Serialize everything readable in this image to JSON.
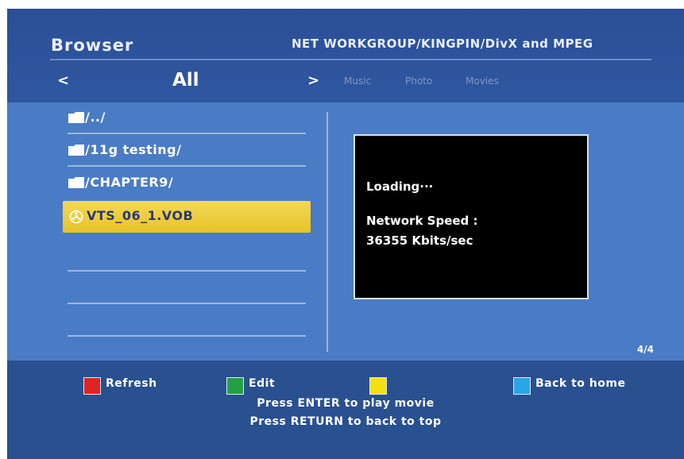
{
  "header": {
    "title": "Browser",
    "path": "NET WORKGROUP/KINGPIN/DivX and MPEG"
  },
  "nav": {
    "prev_icon": "chevron-left",
    "prev_glyph": "<",
    "current": "All",
    "next_icon": "chevron-right",
    "next_glyph": ">",
    "tabs": [
      "Music",
      "Photo",
      "Movies"
    ]
  },
  "files": [
    {
      "name": "/../",
      "icon": "folder-icon"
    },
    {
      "name": "/11g testing/",
      "icon": "folder-icon"
    },
    {
      "name": "/CHAPTER9/",
      "icon": "folder-icon"
    },
    {
      "name": "VTS_06_1.VOB",
      "icon": "disc-icon",
      "selected": true
    }
  ],
  "preview": {
    "loading": "Loading···",
    "speed_label": "Network Speed :",
    "speed_value": "36355 Kbits/sec"
  },
  "page_counter": "4/4",
  "footer": {
    "keys": [
      {
        "color": "#e02424",
        "label": "Refresh"
      },
      {
        "color": "#23a046",
        "label": "Edit"
      },
      {
        "color": "#f2e20a",
        "label": ""
      },
      {
        "color": "#2aa6e6",
        "label": "Back to home"
      }
    ],
    "hint1": "Press ENTER to play movie",
    "hint2": "Press RETURN to back to top"
  },
  "colors": {
    "accent": "#2a4f96",
    "content_bg": "#4a7cc5",
    "selected": "#ecc935"
  }
}
